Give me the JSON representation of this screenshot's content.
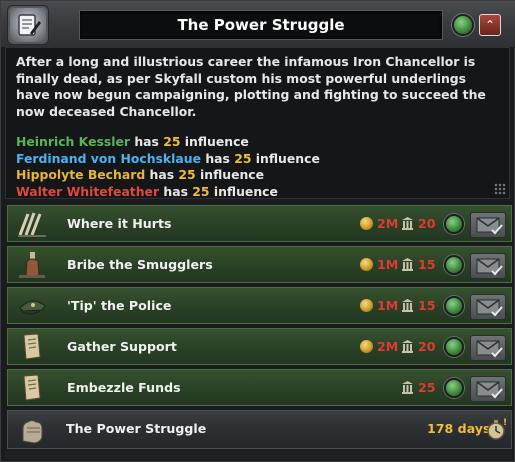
{
  "window": {
    "title": "The Power Struggle"
  },
  "description": {
    "intro": "After a long and illustrious career the infamous Iron Chancellor is finally dead, as per Skyfall custom his most powerful underlings have now begun campaigning, plotting and fighting to succeed the now deceased Chancellor.",
    "has_text": "has",
    "influence_word": "influence",
    "contenders": [
      {
        "name": "Heinrich Kessler",
        "value": "25",
        "color": "#59b45e"
      },
      {
        "name": "Ferdinand von Hochsklaue",
        "value": "25",
        "color": "#4db2f2"
      },
      {
        "name": "Hippolyte Bechard",
        "value": "25",
        "color": "#e8b736"
      },
      {
        "name": "Walter Whitefeather",
        "value": "25",
        "color": "#e04a3e"
      }
    ]
  },
  "decisions": [
    {
      "label": "Where it Hurts",
      "money": "2M",
      "pp": "20",
      "icon": "claw-marks-icon"
    },
    {
      "label": "Bribe the Smugglers",
      "money": "1M",
      "pp": "15",
      "icon": "bottle-icon"
    },
    {
      "label": "'Tip' the Police",
      "money": "1M",
      "pp": "15",
      "icon": "police-cap-icon"
    },
    {
      "label": "Gather Support",
      "money": "2M",
      "pp": "20",
      "icon": "documents-icon"
    },
    {
      "label": "Embezzle Funds",
      "money": "",
      "pp": "25",
      "icon": "documents-icon"
    }
  ],
  "mission": {
    "label": "The Power Struggle",
    "days": "178 days",
    "icon": "fist-icon"
  },
  "colors": {
    "accent_green": "#3f8a3d",
    "cost_red": "#e03a32",
    "highlight_gold": "#f1bc3a"
  }
}
